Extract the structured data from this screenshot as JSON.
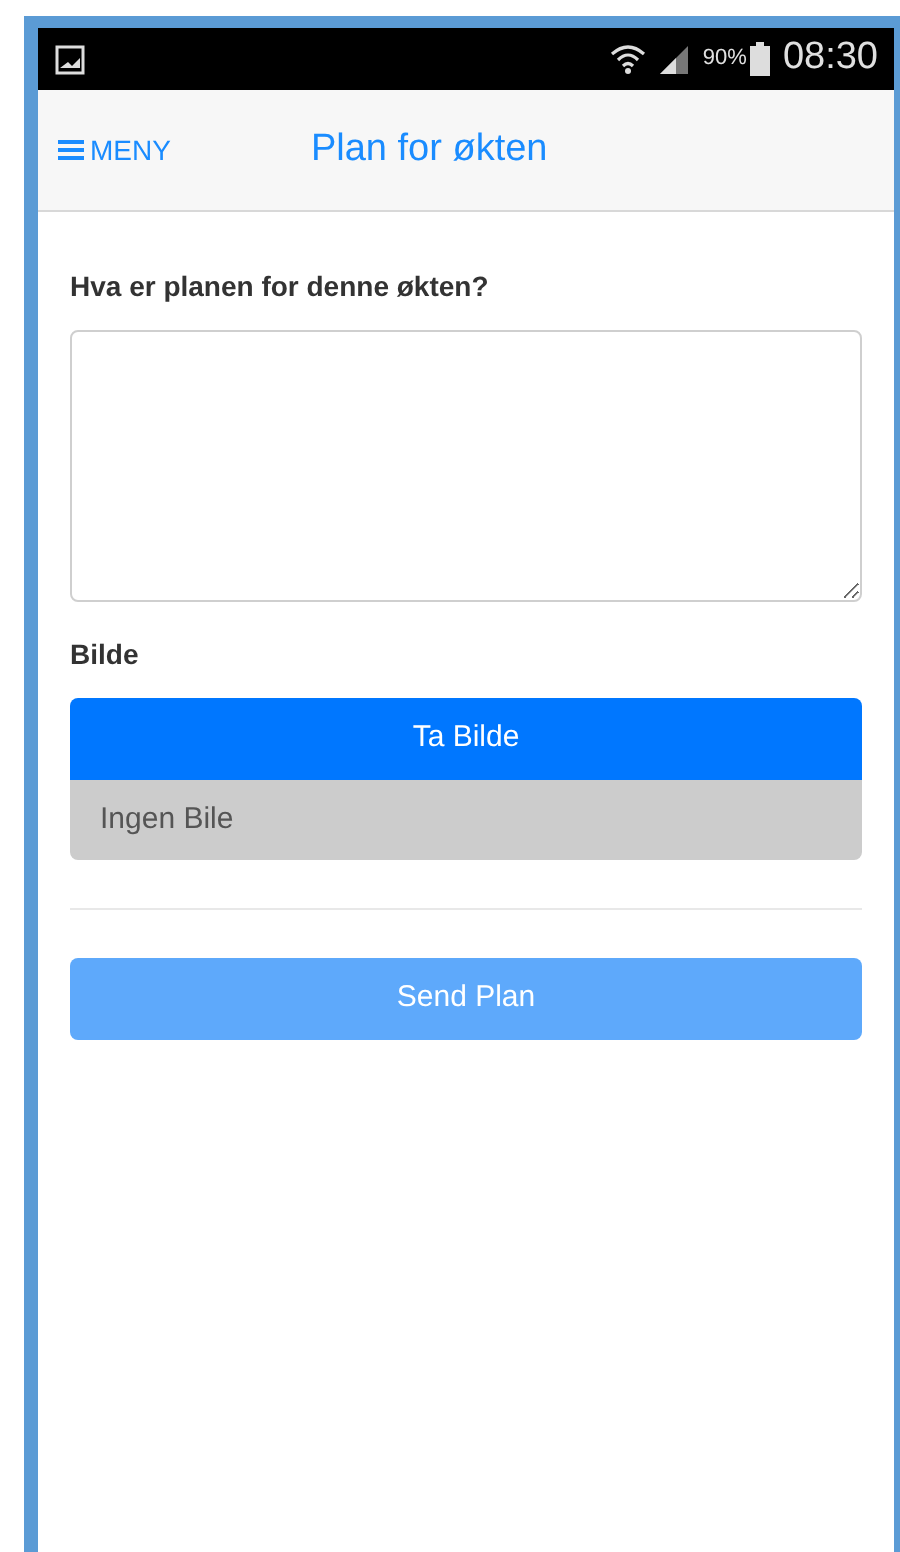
{
  "status_bar": {
    "battery": "90%",
    "time": "08:30"
  },
  "header": {
    "menu": "MENY",
    "title": "Plan for økten"
  },
  "form": {
    "question_label": "Hva er planen for denne økten?",
    "image_label": "Bilde",
    "take_picture_button": "Ta Bilde",
    "image_status": "Ingen Bile",
    "send_button": {
      "label": "Send Plan",
      "disabled": true
    }
  }
}
